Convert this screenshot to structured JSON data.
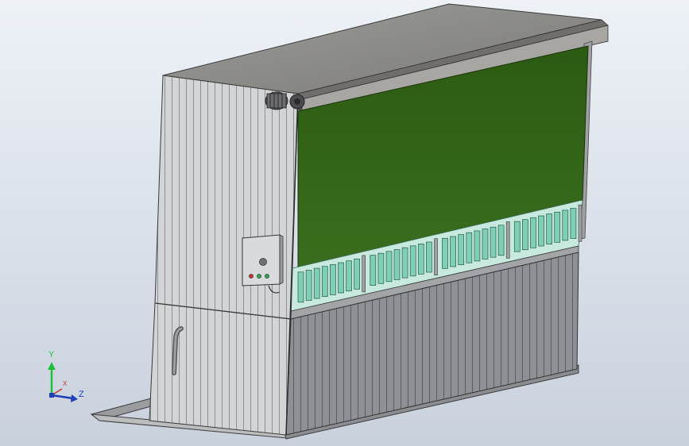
{
  "viewport": {
    "background_top": "#eef2f7",
    "background_bottom": "#c9d1dd"
  },
  "model": {
    "panel_color": "#cfd0d2",
    "screen_color": "#2f5d16",
    "filter_color": "#8fd8c0",
    "frame_color": "#8a8a8a",
    "control_box": {
      "lights": [
        "red",
        "green",
        "green"
      ],
      "light_colors": [
        "#c0392b",
        "#2fa84f",
        "#2fa84f"
      ]
    }
  },
  "triad": {
    "y_label": "Y",
    "z_label": "Z",
    "x_label": "X",
    "y_color": "#1fbf3a",
    "z_color": "#1d3fb8",
    "x_color": "#c0392b"
  }
}
